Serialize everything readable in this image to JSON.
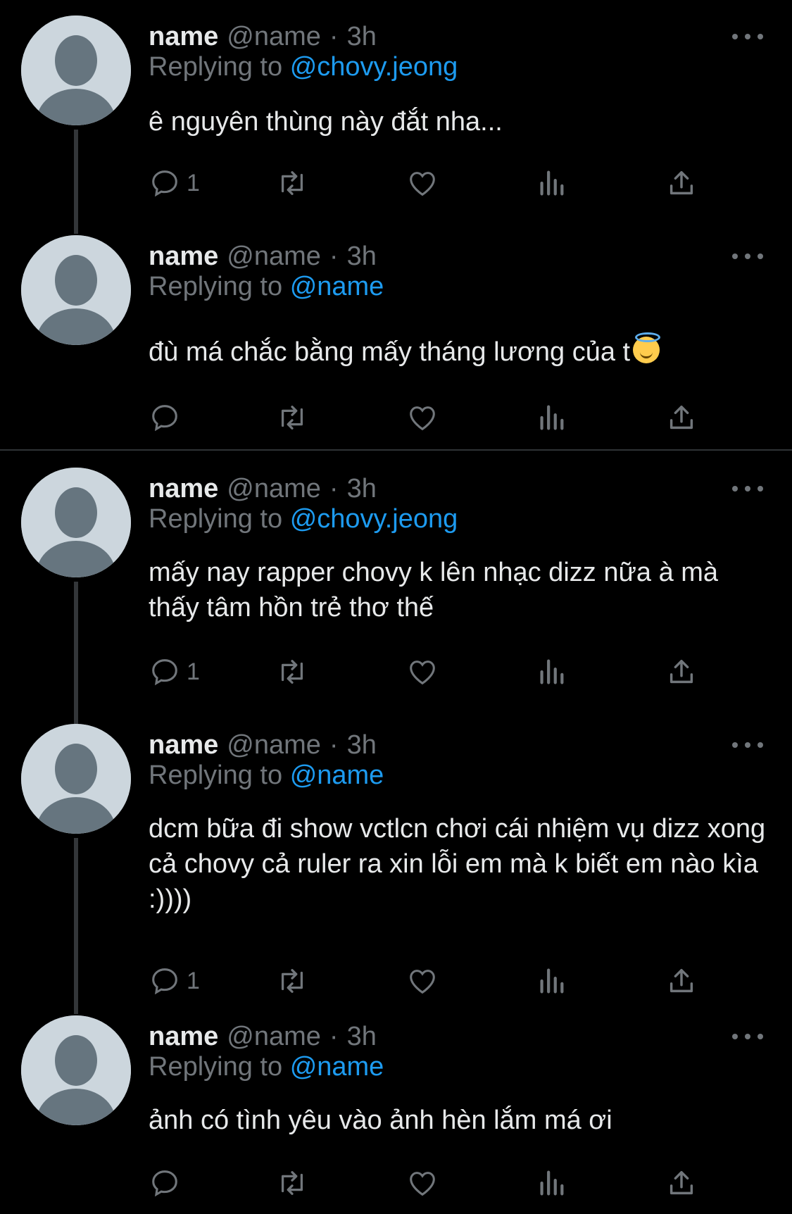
{
  "colors": {
    "background": "#000000",
    "text": "#e7e9ea",
    "muted": "#71767b",
    "link": "#1d9bf0",
    "avatar_bg": "#ccd6dd",
    "avatar_fg": "#66757f"
  },
  "icons": [
    "reply-icon",
    "retweet-icon",
    "like-icon",
    "views-icon",
    "share-icon",
    "more-icon"
  ],
  "tweets": [
    {
      "name": "name",
      "handle": "@name",
      "dot": "·",
      "time": "3h",
      "replying_label": "Replying to",
      "replying_to": "@chovy.jeong",
      "text": "ê nguyên thùng này đắt nha...",
      "reply_count": "1"
    },
    {
      "name": "name",
      "handle": "@name",
      "dot": "·",
      "time": "3h",
      "replying_label": "Replying to",
      "replying_to": "@name",
      "text": "đù má chắc bằng mấy tháng lương của t",
      "emoji": "smiling-face-with-halo",
      "reply_count": ""
    },
    {
      "name": "name",
      "handle": "@name",
      "dot": "·",
      "time": "3h",
      "replying_label": "Replying to",
      "replying_to": "@chovy.jeong",
      "text": "mấy nay rapper chovy k lên nhạc dizz nữa à mà thấy tâm hồn trẻ thơ thế",
      "reply_count": "1"
    },
    {
      "name": "name",
      "handle": "@name",
      "dot": "·",
      "time": "3h",
      "replying_label": "Replying to",
      "replying_to": "@name",
      "text": "dcm bữa đi show vctlcn chơi cái nhiệm vụ dizz xong cả chovy cả ruler ra xin lỗi em mà k biết em nào kìa :))))",
      "reply_count": "1"
    },
    {
      "name": "name",
      "handle": "@name",
      "dot": "·",
      "time": "3h",
      "replying_label": "Replying to",
      "replying_to": "@name",
      "text": "ảnh có tình yêu vào ảnh hèn lắm má ơi",
      "reply_count": ""
    }
  ]
}
